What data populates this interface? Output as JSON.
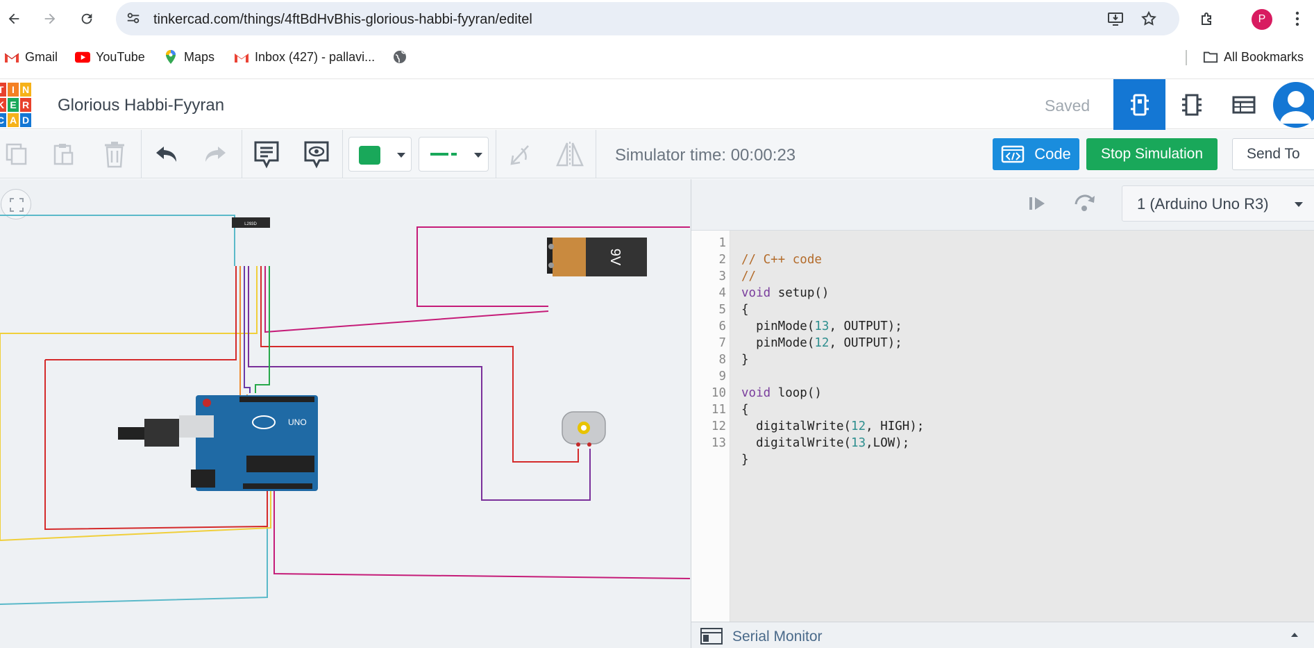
{
  "browser": {
    "url": "tinkercad.com/things/4ftBdHvBhis-glorious-habbi-fyyran/editel",
    "profile_initial": "P",
    "bookmarks": [
      {
        "label": "Gmail",
        "icon": "gmail-icon"
      },
      {
        "label": "YouTube",
        "icon": "youtube-icon"
      },
      {
        "label": "Maps",
        "icon": "maps-icon"
      },
      {
        "label": "Inbox (427) - pallavi...",
        "icon": "gmail-icon"
      }
    ],
    "all_bookmarks": "All Bookmarks"
  },
  "header": {
    "logo_letters": [
      "T",
      "I",
      "N",
      "K",
      "E",
      "R",
      "C",
      "A",
      "D"
    ],
    "logo_colors": [
      "#e8412c",
      "#f48024",
      "#f6b219",
      "#e8412c",
      "#19a85a",
      "#e8412c",
      "#1477d4",
      "#f6b219",
      "#1477d4"
    ],
    "project_title": "Glorious Habbi-Fyyran",
    "save_status": "Saved"
  },
  "toolbar": {
    "simulator_time": "Simulator time: 00:00:23",
    "code_label": "Code",
    "stop_label": "Stop Simulation",
    "send_label": "Send To",
    "color_swatch": "#19a85a"
  },
  "canvas": {
    "chip_label": "L293D",
    "battery_label": "9V",
    "board_label": "UNO"
  },
  "code_panel": {
    "device": "1 (Arduino Uno R3)",
    "line_numbers": [
      "1",
      "2",
      "3",
      "4",
      "5",
      "6",
      "7",
      "8",
      "9",
      "10",
      "11",
      "12",
      "13"
    ],
    "lines": {
      "l1": "// C++ code",
      "l2": "//",
      "l3a": "void",
      "l3b": " setup()",
      "l4": "{",
      "l5a": "  pinMode(",
      "l5b": "13",
      "l5c": ", OUTPUT);",
      "l6a": "  pinMode(",
      "l6b": "12",
      "l6c": ", OUTPUT);",
      "l7": "}",
      "l8": "",
      "l9a": "void",
      "l9b": " loop()",
      "l10": "{",
      "l11a": "  digitalWrite(",
      "l11b": "12",
      "l11c": ", HIGH);",
      "l12a": "  digitalWrite(",
      "l12b": "13",
      "l12c": ",LOW);",
      "l13": "}"
    },
    "serial_monitor": "Serial Monitor"
  }
}
